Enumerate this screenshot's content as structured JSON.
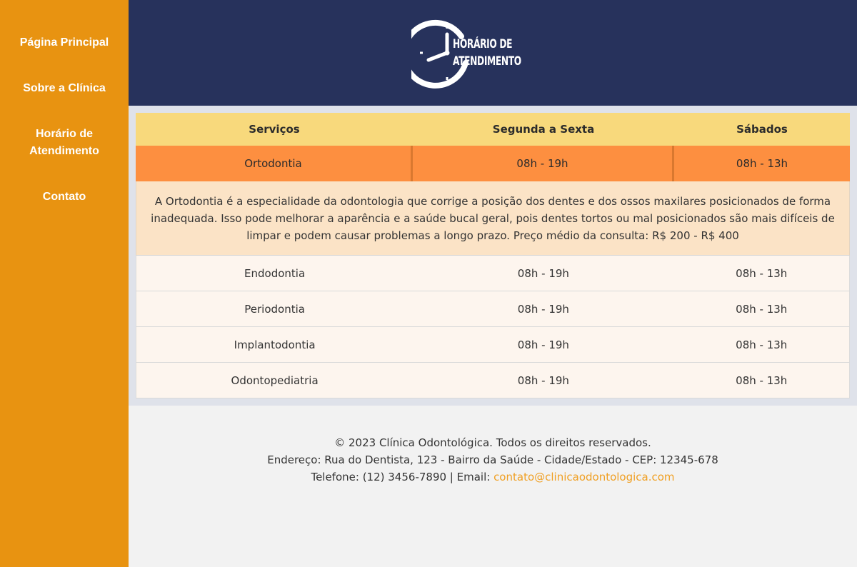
{
  "sidebar": {
    "items": [
      {
        "label": "Página Principal"
      },
      {
        "label": "Sobre a Clínica"
      },
      {
        "label_line1": "Horário de",
        "label_line2": "Atendimento"
      },
      {
        "label": "Contato"
      }
    ]
  },
  "header": {
    "logo_line1": "Horário de",
    "logo_line2": "Atendimento",
    "logo_icon": "clock-icon"
  },
  "table": {
    "headers": [
      "Serviços",
      "Segunda a Sexta",
      "Sábados"
    ],
    "active_row": {
      "service": "Ortodontia",
      "weekdays": "08h - 19h",
      "saturday": "08h - 13h"
    },
    "description": "A Ortodontia é a especialidade da odontologia que corrige a posição dos dentes e dos ossos maxilares posicionados de forma inadequada. Isso pode melhorar a aparência e a saúde bucal geral, pois dentes tortos ou mal posicionados são mais difíceis de limpar e podem causar problemas a longo prazo. Preço médio da consulta: R$ 200 - R$ 400",
    "rows": [
      {
        "service": "Endodontia",
        "weekdays": "08h - 19h",
        "saturday": "08h - 13h"
      },
      {
        "service": "Periodontia",
        "weekdays": "08h - 19h",
        "saturday": "08h - 13h"
      },
      {
        "service": "Implantodontia",
        "weekdays": "08h - 19h",
        "saturday": "08h - 13h"
      },
      {
        "service": "Odontopediatria",
        "weekdays": "08h - 19h",
        "saturday": "08h - 13h"
      }
    ]
  },
  "footer": {
    "copyright": "© 2023 Clínica Odontológica. Todos os direitos reservados.",
    "address": "Endereço: Rua do Dentista, 123 - Bairro da Saúde - Cidade/Estado - CEP: 12345-678",
    "phone_prefix": "Telefone: (12) 3456-7890 | Email: ",
    "email": "contato@clinicaodontologica.com"
  },
  "colors": {
    "sidebar": "#e89311",
    "header": "#27325c",
    "table_header": "#f8d97c",
    "active_row": "#fd8f40",
    "description_bg": "#fbe3c6",
    "row_bg": "#fdf5ee",
    "link": "#f0a024"
  }
}
